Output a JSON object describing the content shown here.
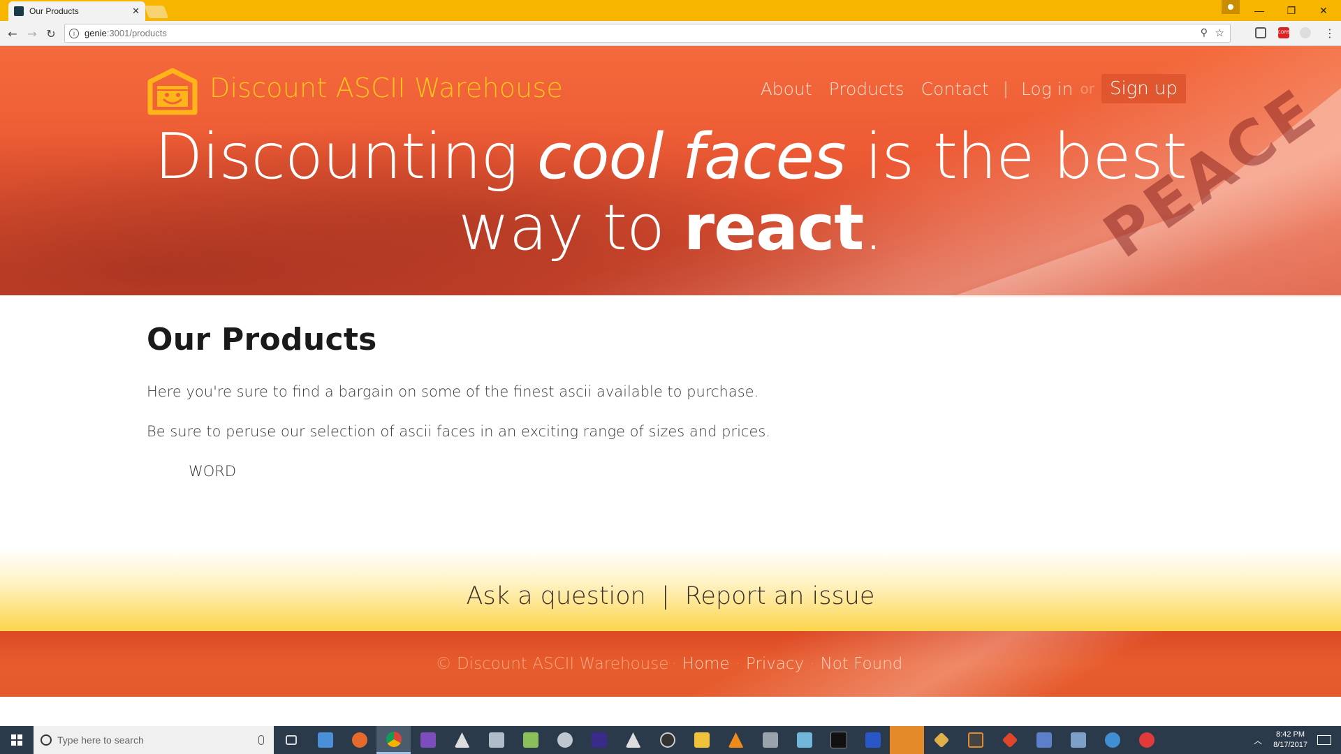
{
  "browser": {
    "tab_title": "Our Products",
    "tab_close": "✕",
    "url_host": "genie",
    "url_path": ":3001/products",
    "window_controls": [
      "—",
      "❐",
      "✕"
    ],
    "ext_label": "CORS"
  },
  "site": {
    "brand": "Discount ASCII Warehouse",
    "nav": {
      "about": "About",
      "products": "Products",
      "contact": "Contact",
      "separator": "|",
      "login": "Log in",
      "or": "or",
      "signup": "Sign up"
    },
    "hero": {
      "line1_a": "Discounting ",
      "line1_em": "cool faces",
      "line1_b": " is the best",
      "line2_a": "way to ",
      "line2_strong": "react",
      "line2_b": "."
    },
    "hero_image_text": "PEACE"
  },
  "main": {
    "title": "Our Products",
    "paragraph1": "Here you're sure to find a bargain on some of the finest ascii available to purchase.",
    "paragraph2": "Be sure to peruse our selection of ascii faces in an exciting range of sizes and prices.",
    "list_item": "WORD"
  },
  "footer": {
    "ask": "Ask a question",
    "divider": "|",
    "report": "Report an issue",
    "copyright": "© Discount ASCII Warehouse",
    "dot": "·",
    "links": [
      "Home",
      "Privacy",
      "Not Found"
    ]
  },
  "taskbar": {
    "search_placeholder": "Type here to search",
    "time": "8:42 PM",
    "date": "8/17/2017"
  },
  "colors": {
    "titlebar": "#f8b500",
    "hero_orange": "#ec5a34",
    "brand_yellow": "#ffc61a",
    "footer_yellow": "#fcd54d"
  }
}
